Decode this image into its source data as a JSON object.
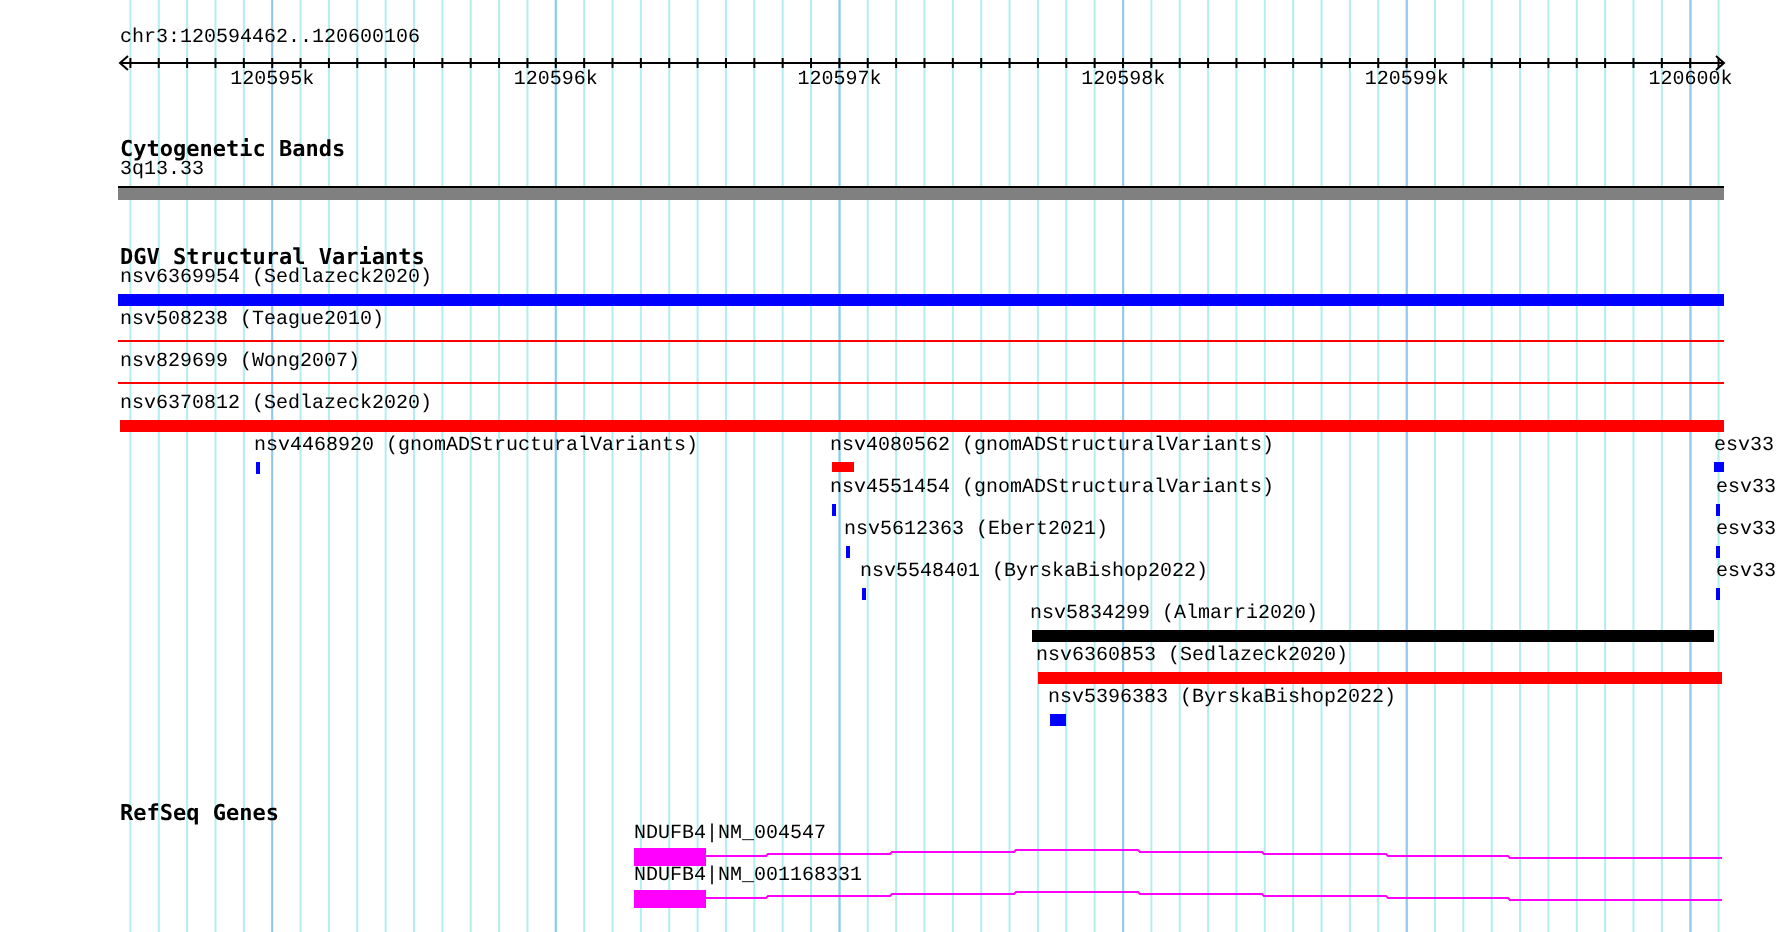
{
  "ruler": {
    "location": "chr3:120594462..120600106",
    "ticks": [
      "120595k",
      "120596k",
      "120597k",
      "120598k",
      "120599k",
      "120600k"
    ]
  },
  "tracks": [
    {
      "title": "Cytogenetic Bands",
      "features": [
        {
          "label": "3q13.33",
          "kind": "band",
          "color": "#808080"
        }
      ]
    },
    {
      "title": "DGV Structural Variants",
      "features": [
        {
          "label": "nsv6369954 (Sedlazeck2020)",
          "kind": "bar",
          "color": "#0000ff"
        },
        {
          "label": "nsv508238 (Teague2010)",
          "kind": "line",
          "color": "#ff0000"
        },
        {
          "label": "nsv829699 (Wong2007)",
          "kind": "line",
          "color": "#ff0000"
        },
        {
          "label": "nsv6370812 (Sedlazeck2020)",
          "kind": "bar",
          "color": "#ff0000"
        },
        {
          "label": "nsv4468920 (gnomADStructuralVariants)",
          "kind": "bar",
          "color": "#0000ff"
        },
        {
          "label": "nsv4080562 (gnomADStructuralVariants)",
          "kind": "bar",
          "color": "#ff0000"
        },
        {
          "label": "esv33",
          "kind": "bar",
          "color": "#0000ff"
        },
        {
          "label": "nsv4551454 (gnomADStructuralVariants)",
          "kind": "bar",
          "color": "#0000ff"
        },
        {
          "label": "esv33",
          "kind": "bar",
          "color": "#0000ff"
        },
        {
          "label": "nsv5612363 (Ebert2021)",
          "kind": "bar",
          "color": "#0000ff"
        },
        {
          "label": "esv33",
          "kind": "bar",
          "color": "#0000ff"
        },
        {
          "label": "nsv5548401 (ByrskaBishop2022)",
          "kind": "bar",
          "color": "#0000ff"
        },
        {
          "label": "esv33",
          "kind": "bar",
          "color": "#0000ff"
        },
        {
          "label": "nsv5834299 (Almarri2020)",
          "kind": "bar",
          "color": "#000000"
        },
        {
          "label": "nsv6360853 (Sedlazeck2020)",
          "kind": "bar",
          "color": "#ff0000"
        },
        {
          "label": "nsv5396383 (ByrskaBishop2022)",
          "kind": "bar",
          "color": "#0000ff"
        }
      ]
    },
    {
      "title": "RefSeq Genes",
      "features": [
        {
          "label": "NDUFB4|NM_004547",
          "kind": "gene",
          "color": "#ff00ff"
        },
        {
          "label": "NDUFB4|NM_001168331",
          "kind": "gene",
          "color": "#ff00ff"
        }
      ]
    }
  ]
}
